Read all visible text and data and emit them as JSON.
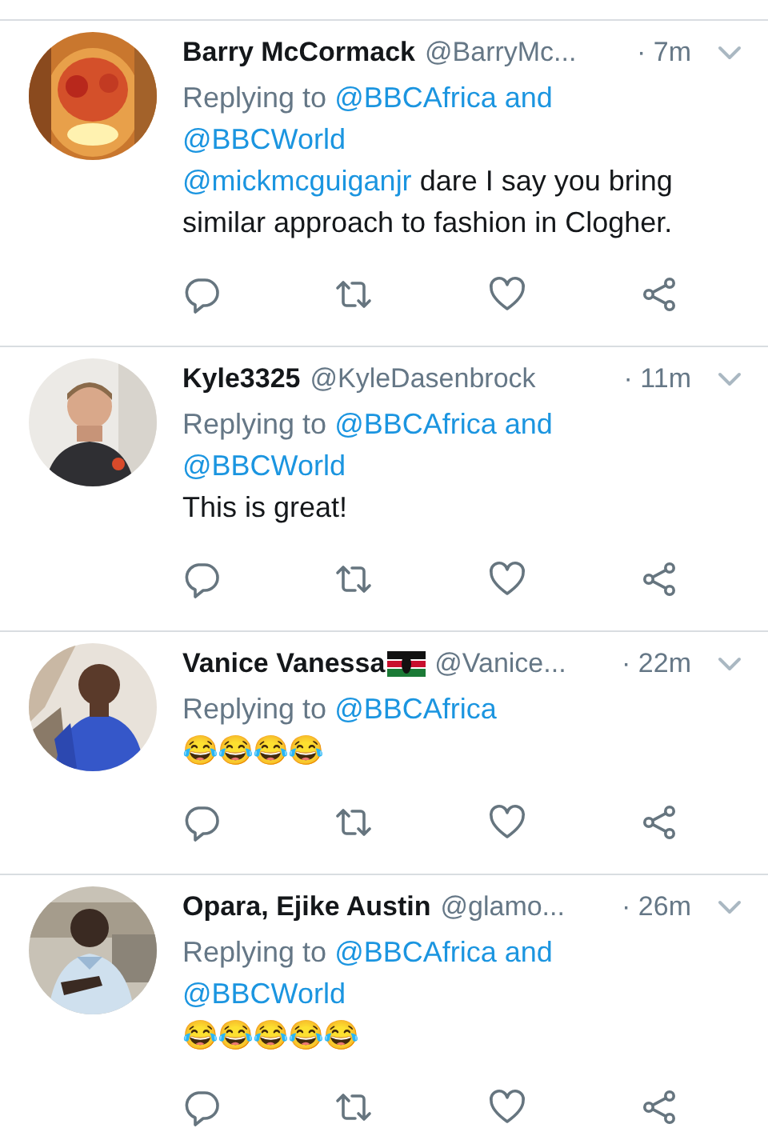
{
  "tweets": [
    {
      "name": "Barry McCormack",
      "handle": "@BarryMc...",
      "time": "· 7m",
      "replying": {
        "prefix": "Replying to",
        "targets": [
          "@BBCAfrica",
          "@BBCWorld"
        ],
        "joiner": "and"
      },
      "body": {
        "mention": "@mickmcguiganjr",
        "text": "dare I say you bring similar approach to fashion in Clogher."
      },
      "flag": false
    },
    {
      "name": "Kyle3325",
      "handle": "@KyleDasenbrock",
      "time": "· 11m",
      "replying": {
        "prefix": "Replying to",
        "targets": [
          "@BBCAfrica",
          "@BBCWorld"
        ],
        "joiner": "and"
      },
      "body": {
        "text": "This is great!"
      },
      "flag": false
    },
    {
      "name": "Vanice Vanessa",
      "handle": "@Vanice...",
      "time": "· 22m",
      "replying": {
        "prefix": "Replying to",
        "targets": [
          "@BBCAfrica"
        ]
      },
      "body": {
        "text": "😂😂😂😂"
      },
      "flag": true
    },
    {
      "name": "Opara, Ejike Austin",
      "handle": "@glamo...",
      "time": "· 26m",
      "replying": {
        "prefix": "Replying to",
        "targets": [
          "@BBCAfrica",
          "@BBCWorld"
        ],
        "joiner": "and"
      },
      "body": {
        "text": "😂😂😂😂😂"
      },
      "flag": false
    }
  ]
}
